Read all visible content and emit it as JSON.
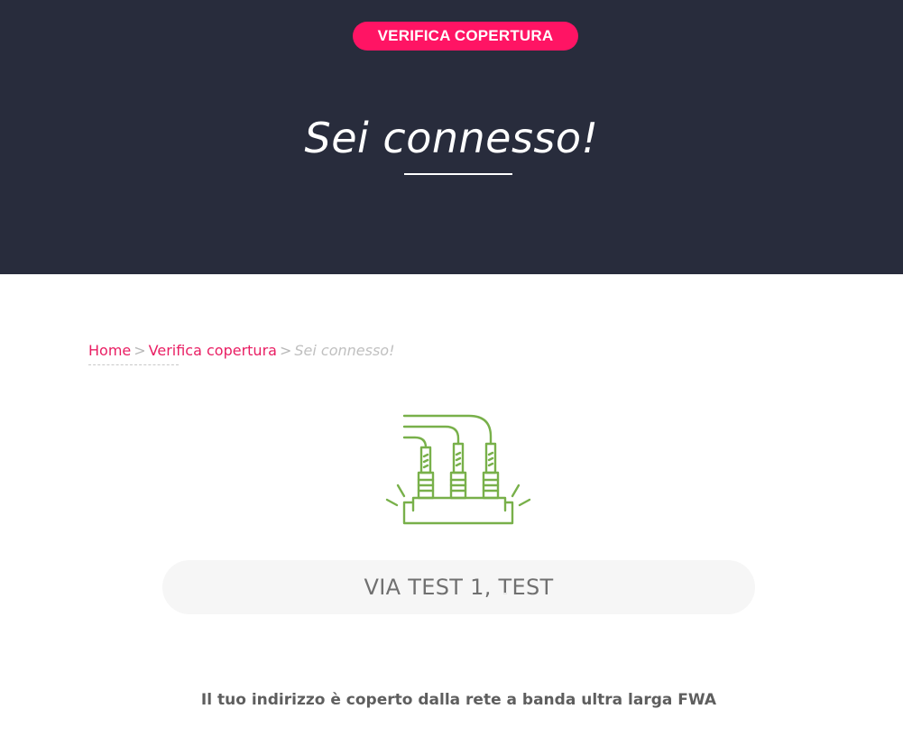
{
  "hero": {
    "badge_label": "VERIFICA COPERTURA",
    "title": "Sei connesso!",
    "background_color": "#282c3c",
    "accent_color": "#ff1464"
  },
  "breadcrumb": {
    "items": [
      {
        "label": "Home"
      },
      {
        "label": "Verifica copertura"
      },
      {
        "label": "Sei connesso!"
      }
    ],
    "separator": ">"
  },
  "illustration": {
    "icon": "fiber-connectors-icon",
    "color": "#78b04a"
  },
  "address": {
    "value": "VIA TEST 1, TEST"
  },
  "coverage_message": "Il tuo indirizzo è coperto dalla rete a banda ultra larga FWA"
}
